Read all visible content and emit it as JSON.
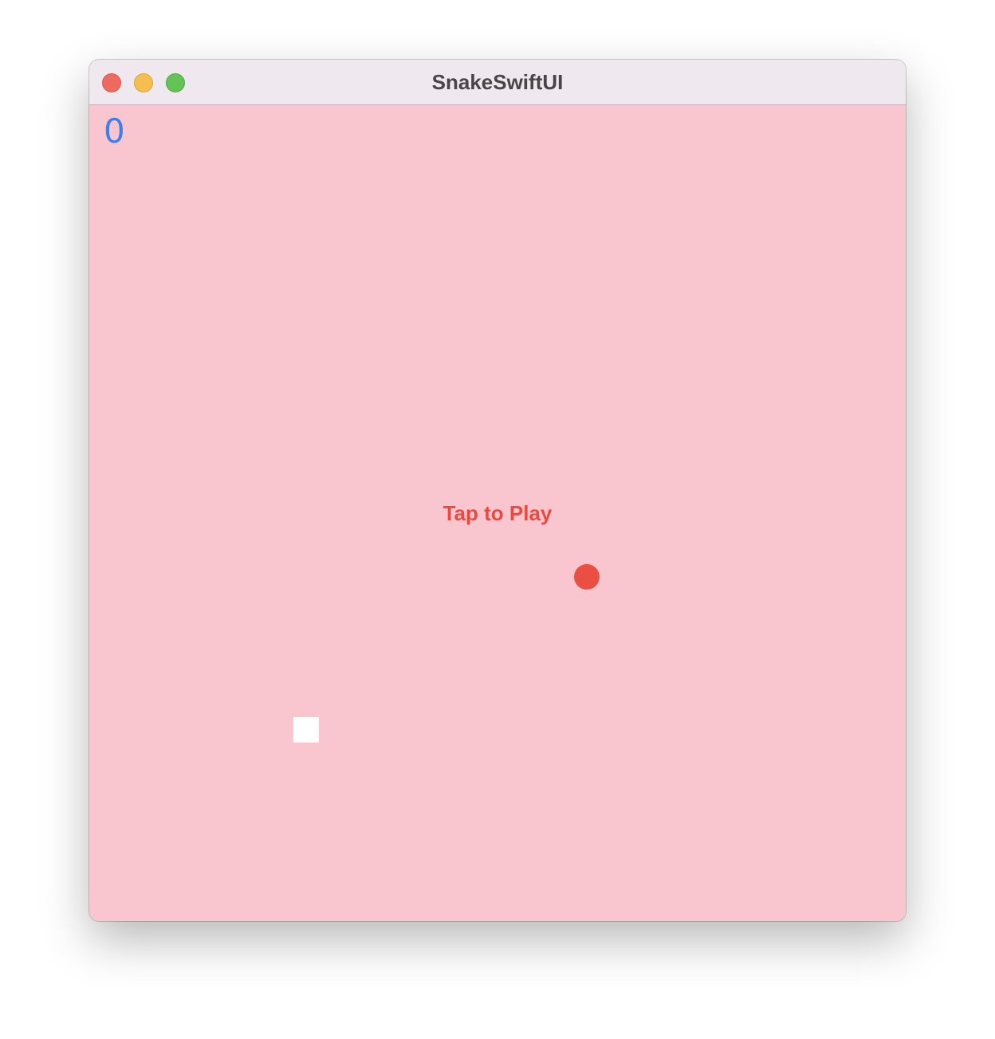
{
  "window": {
    "title": "SnakeSwiftUI"
  },
  "game": {
    "score": "0",
    "prompt": "Tap to Play",
    "colors": {
      "background": "#f9c6cf",
      "score": "#3b7ff0",
      "prompt": "#ea4a3e",
      "food": "#ea4f42",
      "snake": "#ffffff"
    }
  }
}
